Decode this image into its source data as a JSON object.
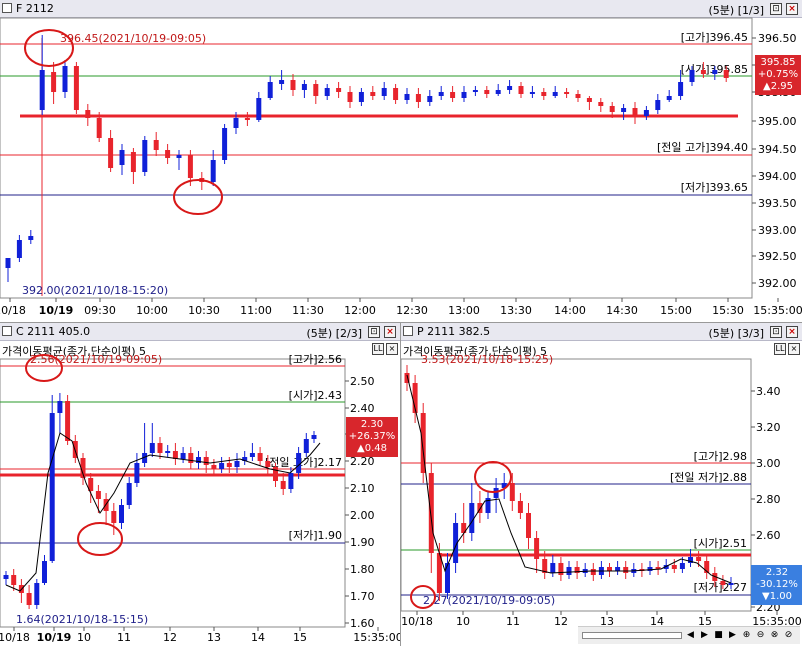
{
  "panel1": {
    "title": "F 2112",
    "right": "(5분) [1/3]",
    "high_note": "396.45(2021/10/19-09:05)",
    "low_note": "392.00(2021/10/18-15:20)",
    "labels": {
      "high": "[고가]396.45",
      "open": "[시가]395.85",
      "prev_high": "[전일 고가]394.40",
      "low": "[저가]393.65"
    },
    "price_box": [
      "395.85",
      "+0.75%",
      "▲2.95"
    ],
    "y_ticks": [
      "396.50",
      "396.00",
      "395.50",
      "395.00",
      "394.50",
      "394.00",
      "393.50",
      "393.00",
      "392.50",
      "392.00"
    ],
    "x_ticks": [
      "10/18",
      "10/19",
      "09:30",
      "10:00",
      "10:30",
      "11:00",
      "11:30",
      "12:00",
      "12:30",
      "13:00",
      "13:30",
      "14:00",
      "14:30",
      "15:00",
      "15:30",
      "15:35:00"
    ]
  },
  "panel2": {
    "title": "C 2111 405.0",
    "right": "(5분) [2/3]",
    "ma": "가격이동평균(종가,단순이평) 5",
    "high_note": "2.56(2021/10/19-09:05)",
    "low_note": "1.64(2021/10/18-15:15)",
    "labels": {
      "high": "[고가]2.56",
      "open": "[시가]2.43",
      "prev_high": "[전일 고가]2.17",
      "low": "[저가]1.90"
    },
    "price_box": [
      "2.30",
      "+26.37%",
      "▲0.48"
    ],
    "y_ticks": [
      "2.50",
      "2.40",
      "2.30",
      "2.20",
      "2.10",
      "2.00",
      "1.90",
      "1.80",
      "1.70",
      "1.60"
    ],
    "x_ticks": [
      "10/18",
      "10/19",
      "10",
      "11",
      "12",
      "13",
      "14",
      "15",
      "15:35:00"
    ]
  },
  "panel3": {
    "title": "P 2111 382.5",
    "right": "(5분) [3/3]",
    "ma": "가격이동평균(종가,단순이평) 5",
    "high_note": "3.53(2021/10/18-15:25)",
    "low_note": "2.27(2021/10/19-09:05)",
    "labels": {
      "high": "[고가]2.98",
      "prev_low": "[전일 저가]2.88",
      "open": "[시가]2.51",
      "low": "[저가]2.27"
    },
    "price_box": [
      "2.32",
      "-30.12%",
      "▼1.00"
    ],
    "y_ticks": [
      "3.40",
      "3.20",
      "3.00",
      "2.80",
      "2.60",
      "2.40",
      "2.20"
    ],
    "x_ticks": [
      "10/18",
      "10",
      "11",
      "12",
      "13",
      "14",
      "15",
      "15:35:00"
    ]
  },
  "colors": {
    "up": "#e8242c",
    "down": "#1020d8",
    "hline_red": "#e8242c",
    "hline_green": "#2a9a2a",
    "hline_navy": "#20208a"
  }
}
